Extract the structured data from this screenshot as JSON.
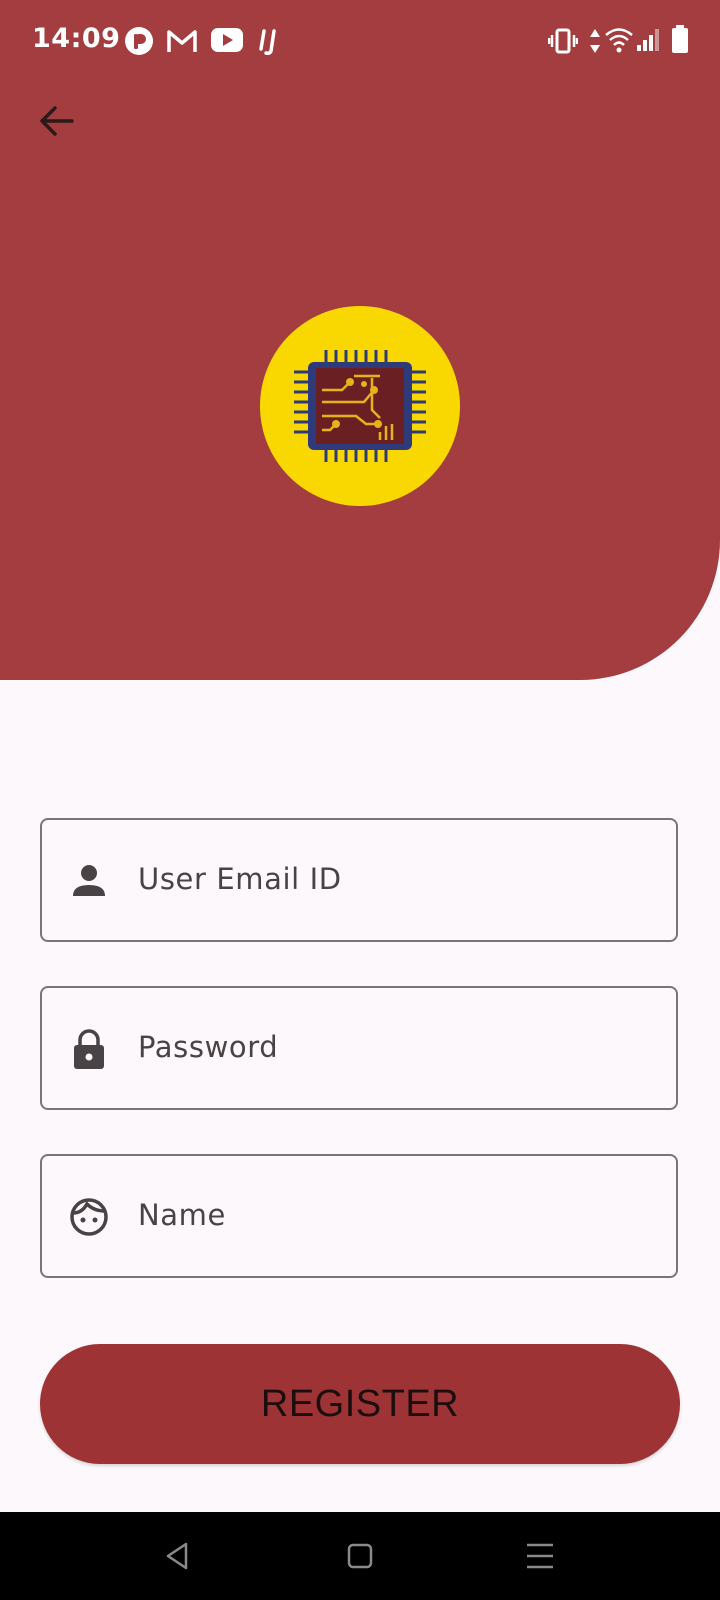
{
  "status_bar": {
    "time": "14:09",
    "app_icons": [
      "tumblr-icon",
      "gmail-icon",
      "youtube-icon",
      "ij-icon"
    ],
    "system_icons": [
      "vibrate-icon",
      "data-arrows-icon",
      "wifi-icon",
      "signal-icon",
      "battery-icon"
    ]
  },
  "header": {
    "background": "#A33D3F",
    "back_icon": "arrow-left-icon",
    "logo_icon": "circuit-chip-icon",
    "logo_background": "#F8D800"
  },
  "form": {
    "fields": [
      {
        "icon": "person-icon",
        "label": "User Email ID"
      },
      {
        "icon": "lock-icon",
        "label": "Password"
      },
      {
        "icon": "face-icon",
        "label": "Name"
      }
    ],
    "submit_label": "REGISTER",
    "submit_color": "#9E3335"
  },
  "nav_bar": {
    "icons": [
      "back-triangle-icon",
      "home-square-icon",
      "menu-lines-icon"
    ]
  }
}
